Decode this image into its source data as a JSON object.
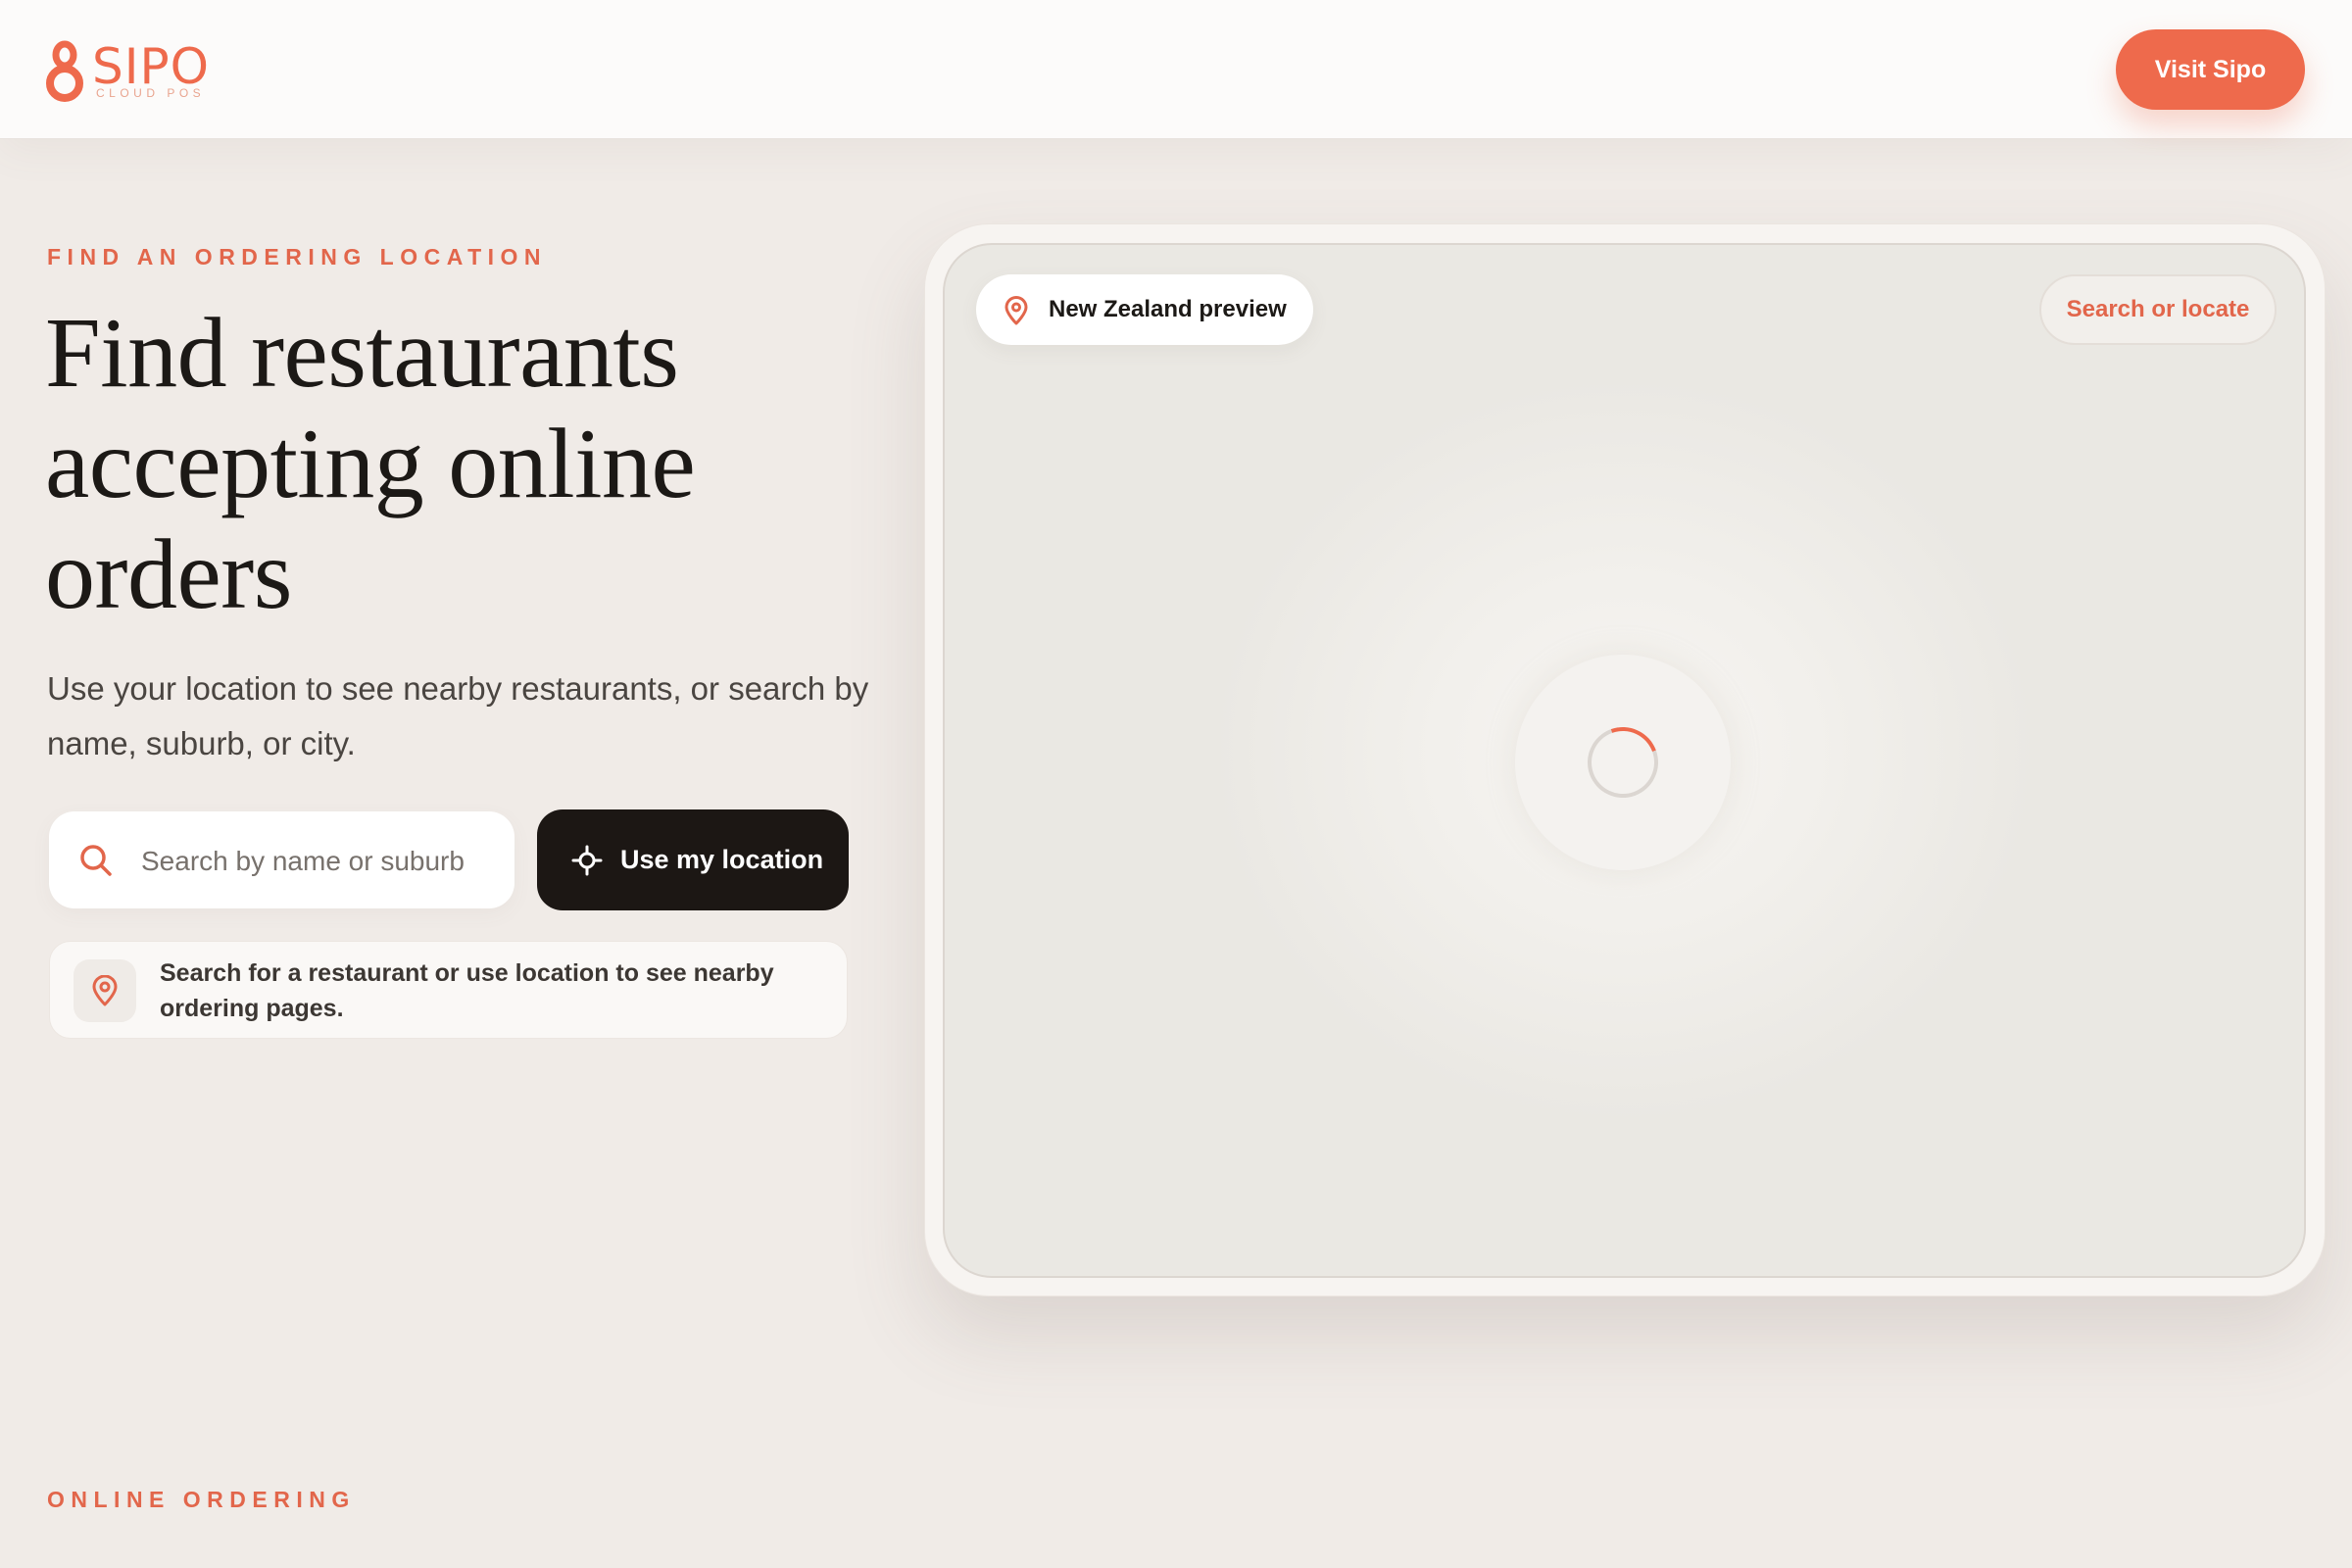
{
  "header": {
    "logo_text": "SIPO",
    "logo_subtext": "CLOUD POS",
    "visit_button": "Visit Sipo"
  },
  "hero": {
    "eyebrow": "FIND AN ORDERING LOCATION",
    "title": "Find restaurants accepting online orders",
    "subtitle": "Use your location to see nearby restaurants, or search by name, suburb, or city."
  },
  "search": {
    "placeholder": "Search by name or suburb",
    "value": ""
  },
  "location_button": "Use my location",
  "hint_text": "Search for a restaurant or use location to see nearby ordering pages.",
  "map": {
    "region_label": "New Zealand preview",
    "search_button": "Search or locate"
  },
  "section_eyebrow": "ONLINE ORDERING",
  "colors": {
    "accent": "#ee6a4c",
    "dark_button": "#1c1714",
    "background": "#f0ebe7"
  }
}
